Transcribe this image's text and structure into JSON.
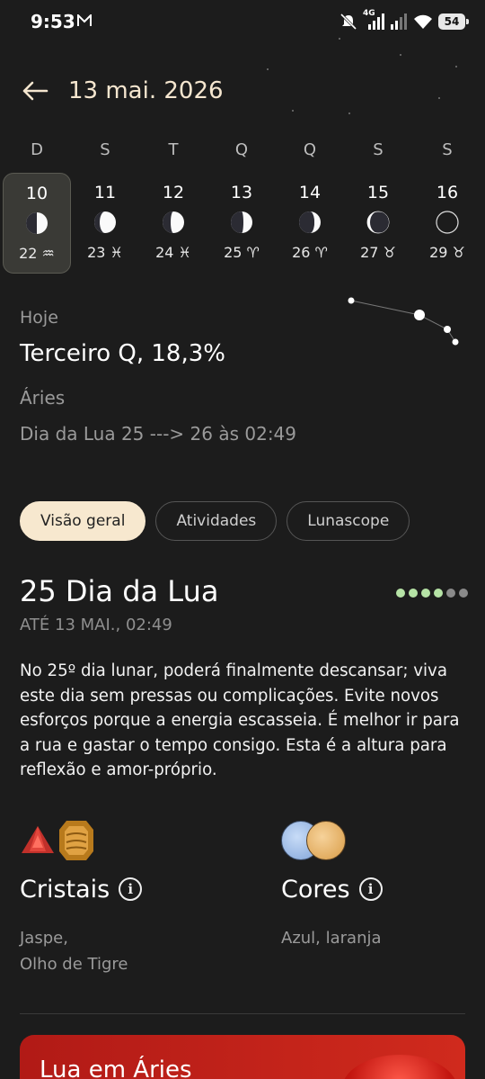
{
  "status": {
    "time": "9:53",
    "network": "4G",
    "battery": "54"
  },
  "header": {
    "title": "13 mai. 2026"
  },
  "week": [
    {
      "letter": "D",
      "day": "10",
      "sign": "22 ♒",
      "phase": "first-quarter",
      "selected": true
    },
    {
      "letter": "S",
      "day": "11",
      "sign": "23 ♓",
      "phase": "waning-gibbous"
    },
    {
      "letter": "T",
      "day": "12",
      "sign": "24 ♓",
      "phase": "waning-gibbous"
    },
    {
      "letter": "Q",
      "day": "13",
      "sign": "25 ♈",
      "phase": "third-quarter"
    },
    {
      "letter": "Q",
      "day": "14",
      "sign": "26 ♈",
      "phase": "waning-crescent"
    },
    {
      "letter": "S",
      "day": "15",
      "sign": "27 ♉",
      "phase": "waning-crescent-thin"
    },
    {
      "letter": "S",
      "day": "16",
      "sign": "29 ♉",
      "phase": "new"
    }
  ],
  "today": {
    "label": "Hoje",
    "phase": "Terceiro Q, 18,3%",
    "sign": "Áries",
    "lunar_day": "Dia da Lua 25 ---> 26 às 02:49"
  },
  "tabs": [
    {
      "label": "Visão geral",
      "active": true
    },
    {
      "label": "Atividades",
      "active": false
    },
    {
      "label": "Lunascope",
      "active": false
    }
  ],
  "section": {
    "title": "25 Dia da Lua",
    "subtitle": "ATÉ 13 MAI., 02:49",
    "rating_dots": [
      "#b6e3a6",
      "#b6e3a6",
      "#b6e3a6",
      "#b6e3a6",
      "#8a8a8a",
      "#8a8a8a"
    ],
    "description": "No 25º dia lunar, poderá finalmente descansar; viva este dia sem pressas ou complicações. Evite novos esforços porque a energia escasseia. É melhor ir para a rua e gastar o tempo consigo. Esta é a altura para reflexão e amor-próprio."
  },
  "crystals": {
    "title": "Cristais",
    "line1": "Jaspe,",
    "line2": "Olho de Tigre"
  },
  "colors": {
    "title": "Cores",
    "text": "Azul, laranja",
    "swatches": [
      "#9dbbe6",
      "#e8b56a"
    ]
  },
  "promo": {
    "title": "Lua em Áries"
  }
}
